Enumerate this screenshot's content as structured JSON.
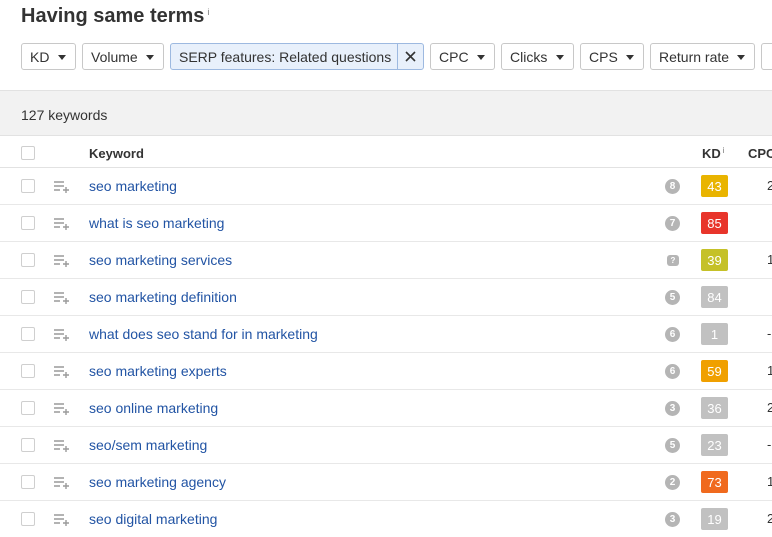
{
  "page": {
    "title": "Having same terms",
    "title_info": "i"
  },
  "filters": [
    {
      "label": "KD"
    },
    {
      "label": "Volume"
    },
    {
      "label": "SERP features: Related questions",
      "active": true
    },
    {
      "label": "CPC"
    },
    {
      "label": "Clicks"
    },
    {
      "label": "CPS"
    },
    {
      "label": "Return rate"
    }
  ],
  "summary": {
    "count_text": "127 keywords"
  },
  "table": {
    "headers": {
      "keyword": "Keyword",
      "kd": "KD",
      "kd_info": "i",
      "cpc": "CPC"
    },
    "rows": [
      {
        "keyword": "seo marketing",
        "serp": "8",
        "kd": "43",
        "kd_color": "#e9b400",
        "cpc": "2"
      },
      {
        "keyword": "what is seo marketing",
        "serp": "7",
        "kd": "85",
        "kd_color": "#e8352b",
        "cpc": ""
      },
      {
        "keyword": "seo marketing services",
        "serp": "",
        "serp_icon": "question-icon",
        "kd": "39",
        "kd_color": "#c5c128",
        "cpc": "1"
      },
      {
        "keyword": "seo marketing definition",
        "serp": "5",
        "kd": "84",
        "kd_color": "#c1c1c1",
        "cpc": ""
      },
      {
        "keyword": "what does seo stand for in marketing",
        "serp": "6",
        "kd": "1",
        "kd_color": "#c1c1c1",
        "cpc": "-"
      },
      {
        "keyword": "seo marketing experts",
        "serp": "6",
        "kd": "59",
        "kd_color": "#f0a000",
        "cpc": "1"
      },
      {
        "keyword": "seo online marketing",
        "serp": "3",
        "kd": "36",
        "kd_color": "#c1c1c1",
        "cpc": "2"
      },
      {
        "keyword": "seo/sem marketing",
        "serp": "5",
        "kd": "23",
        "kd_color": "#c1c1c1",
        "cpc": "-"
      },
      {
        "keyword": "seo marketing agency",
        "serp": "2",
        "kd": "73",
        "kd_color": "#f06a1e",
        "cpc": "1"
      },
      {
        "keyword": "seo digital marketing",
        "serp": "3",
        "kd": "19",
        "kd_color": "#c1c1c1",
        "cpc": "2"
      }
    ]
  },
  "colors": {
    "link": "#2254a4",
    "active_filter_bg": "#e8f0fb",
    "count_bar_bg": "#f2f2f2"
  }
}
